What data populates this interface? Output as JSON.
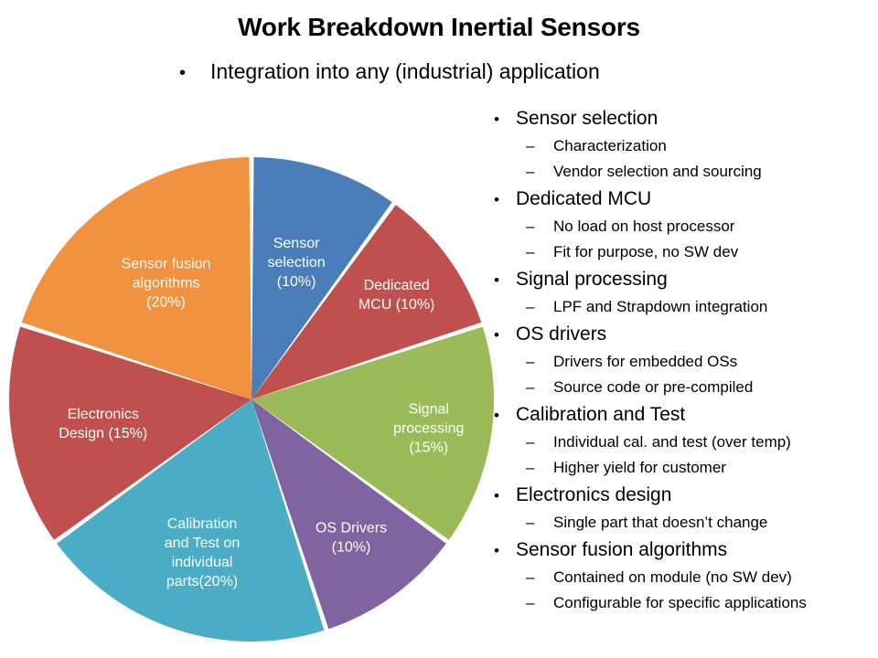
{
  "slide": {
    "title": "Work Breakdown Inertial Sensors",
    "subtitle_bullet_glyph": "•",
    "subtitle": "Integration into any (industrial) application"
  },
  "chart_data": {
    "type": "pie",
    "title": "Work Breakdown Inertial Sensors",
    "legend_position": "none",
    "label_mode": "inside-slice",
    "start_angle_deg": 0,
    "direction": "clockwise",
    "categories": [
      "Sensor selection",
      "Dedicated MCU",
      "Signal processing",
      "OS Drivers",
      "Calibration and Test on individual parts",
      "Electronics Design",
      "Sensor fusion algorithms"
    ],
    "values": [
      10,
      10,
      15,
      10,
      20,
      15,
      20
    ],
    "unit": "%",
    "colors": [
      "#4a7ebb",
      "#bf504d",
      "#9bbb59",
      "#8064a2",
      "#4bacc6",
      "#bf504d",
      "#f0923f"
    ],
    "slices": [
      {
        "name": "Sensor selection",
        "value": 10,
        "color": "#4a7ebb",
        "label_lines": [
          "Sensor",
          "selection",
          "(10%)"
        ]
      },
      {
        "name": "Dedicated MCU",
        "value": 10,
        "color": "#bf504d",
        "label_lines": [
          "Dedicated",
          "MCU (10%)"
        ]
      },
      {
        "name": "Signal processing",
        "value": 15,
        "color": "#9bbb59",
        "label_lines": [
          "Signal",
          "processing",
          "(15%)"
        ]
      },
      {
        "name": "OS Drivers",
        "value": 10,
        "color": "#8064a2",
        "label_lines": [
          "OS Drivers",
          "(10%)"
        ]
      },
      {
        "name": "Calibration and Test on individual parts",
        "value": 20,
        "color": "#4bacc6",
        "label_lines": [
          "Calibration",
          "and Test on",
          "individual",
          "parts(20%)"
        ]
      },
      {
        "name": "Electronics Design",
        "value": 15,
        "color": "#bf504d",
        "label_lines": [
          "Electronics",
          "Design (15%)"
        ]
      },
      {
        "name": "Sensor fusion algorithms",
        "value": 20,
        "color": "#f0923f",
        "label_lines": [
          "Sensor fusion",
          "algorithms",
          "(20%)"
        ]
      }
    ]
  },
  "bullets": {
    "level1_glyph": "•",
    "level2_glyph": "–",
    "items": [
      {
        "label": "Sensor selection",
        "sub": [
          "Characterization",
          "Vendor selection and sourcing"
        ]
      },
      {
        "label": "Dedicated MCU",
        "sub": [
          "No load on host processor",
          "Fit for purpose, no SW dev"
        ]
      },
      {
        "label": "Signal processing",
        "sub": [
          "LPF and Strapdown integration"
        ]
      },
      {
        "label": "OS drivers",
        "sub": [
          "Drivers for embedded OSs",
          "Source code or pre-compiled"
        ]
      },
      {
        "label": "Calibration and Test",
        "sub": [
          "Individual cal. and test (over temp)",
          "Higher yield for customer"
        ]
      },
      {
        "label": "Electronics design",
        "sub": [
          "Single part that doesn’t change"
        ]
      },
      {
        "label": "Sensor fusion algorithms",
        "sub": [
          "Contained on module (no SW dev)",
          "Configurable for specific applications"
        ]
      }
    ]
  }
}
